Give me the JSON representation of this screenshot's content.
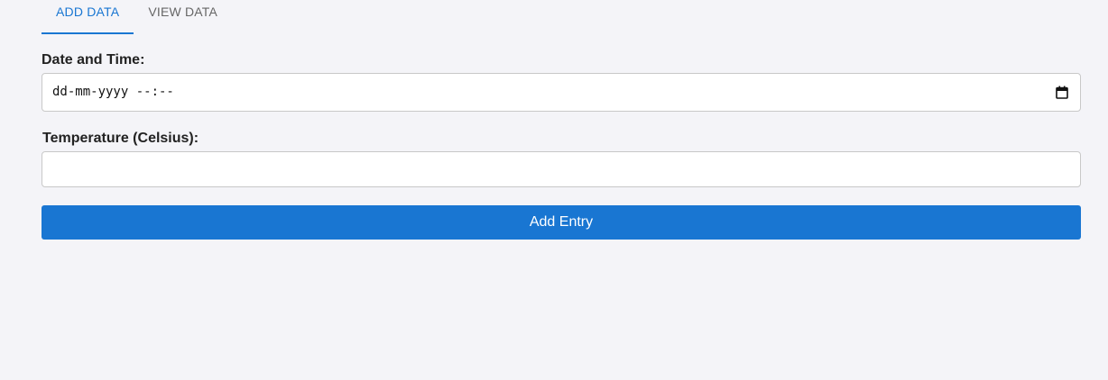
{
  "tabs": [
    {
      "label": "ADD DATA",
      "active": true
    },
    {
      "label": "VIEW DATA",
      "active": false
    }
  ],
  "form": {
    "datetime": {
      "label": "Date and Time:",
      "placeholder": "dd-mm-yyyy --:--",
      "icon": "calendar-icon"
    },
    "temperature": {
      "label": "Temperature (Celsius):",
      "value": ""
    },
    "submit_label": "Add Entry"
  },
  "colors": {
    "accent": "#1976d2",
    "background": "#f4f4f8",
    "tab_inactive": "#666666"
  }
}
